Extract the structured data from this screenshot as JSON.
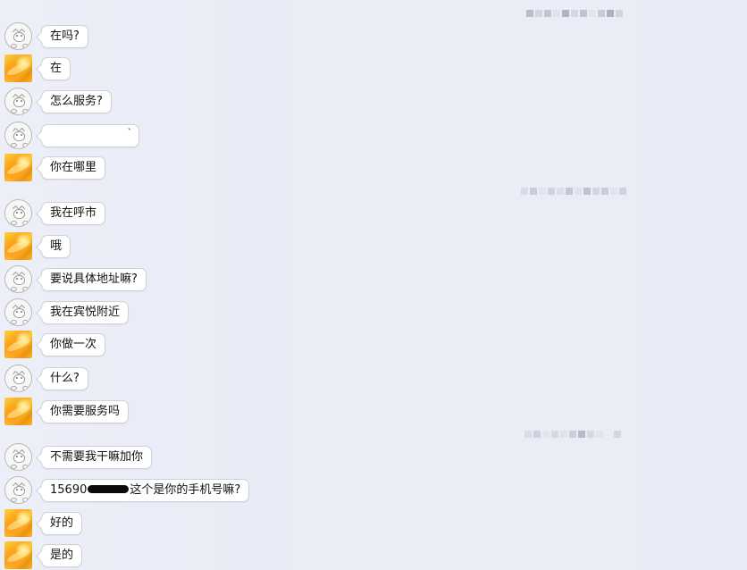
{
  "colors": {
    "bubble_background": "#ffffff",
    "bubble_border": "#cfd1d8",
    "window_background": "#eceef8"
  },
  "messages": [
    {
      "sender": "contact",
      "avatar": "cat-icon",
      "text": "在吗?"
    },
    {
      "sender": "self",
      "avatar": "flower-icon",
      "text": "在"
    },
    {
      "sender": "contact",
      "avatar": "cat-icon",
      "text": "怎么服务?"
    },
    {
      "sender": "contact",
      "avatar": "cat-icon",
      "text": "",
      "redacted": true,
      "trailing": "`"
    },
    {
      "sender": "self",
      "avatar": "flower-icon",
      "text": "你在哪里"
    },
    {
      "sender": "contact",
      "avatar": "cat-icon",
      "text": "我在呼市"
    },
    {
      "sender": "self",
      "avatar": "flower-icon",
      "text": "哦"
    },
    {
      "sender": "contact",
      "avatar": "cat-icon",
      "text": "要说具体地址嘛?"
    },
    {
      "sender": "contact",
      "avatar": "cat-icon",
      "text": "我在宾悦附近"
    },
    {
      "sender": "self",
      "avatar": "flower-icon",
      "text": "你做一次"
    },
    {
      "sender": "contact",
      "avatar": "cat-icon",
      "text": "什么?"
    },
    {
      "sender": "self",
      "avatar": "flower-icon",
      "text": "你需要服务吗"
    },
    {
      "sender": "contact",
      "avatar": "cat-icon",
      "text": "不需要我干嘛加你"
    },
    {
      "sender": "contact",
      "avatar": "cat-icon",
      "text_before": "15690",
      "text_after": "这个是你的手机号嘛?",
      "redacted_inline": true
    },
    {
      "sender": "self",
      "avatar": "flower-icon",
      "text": "好的"
    },
    {
      "sender": "self",
      "avatar": "flower-icon",
      "text": "是的"
    }
  ],
  "timestamps": [
    {
      "label": "pixelated-timestamp"
    },
    {
      "label": "pixelated-timestamp"
    },
    {
      "label": "pixelated-timestamp"
    }
  ]
}
